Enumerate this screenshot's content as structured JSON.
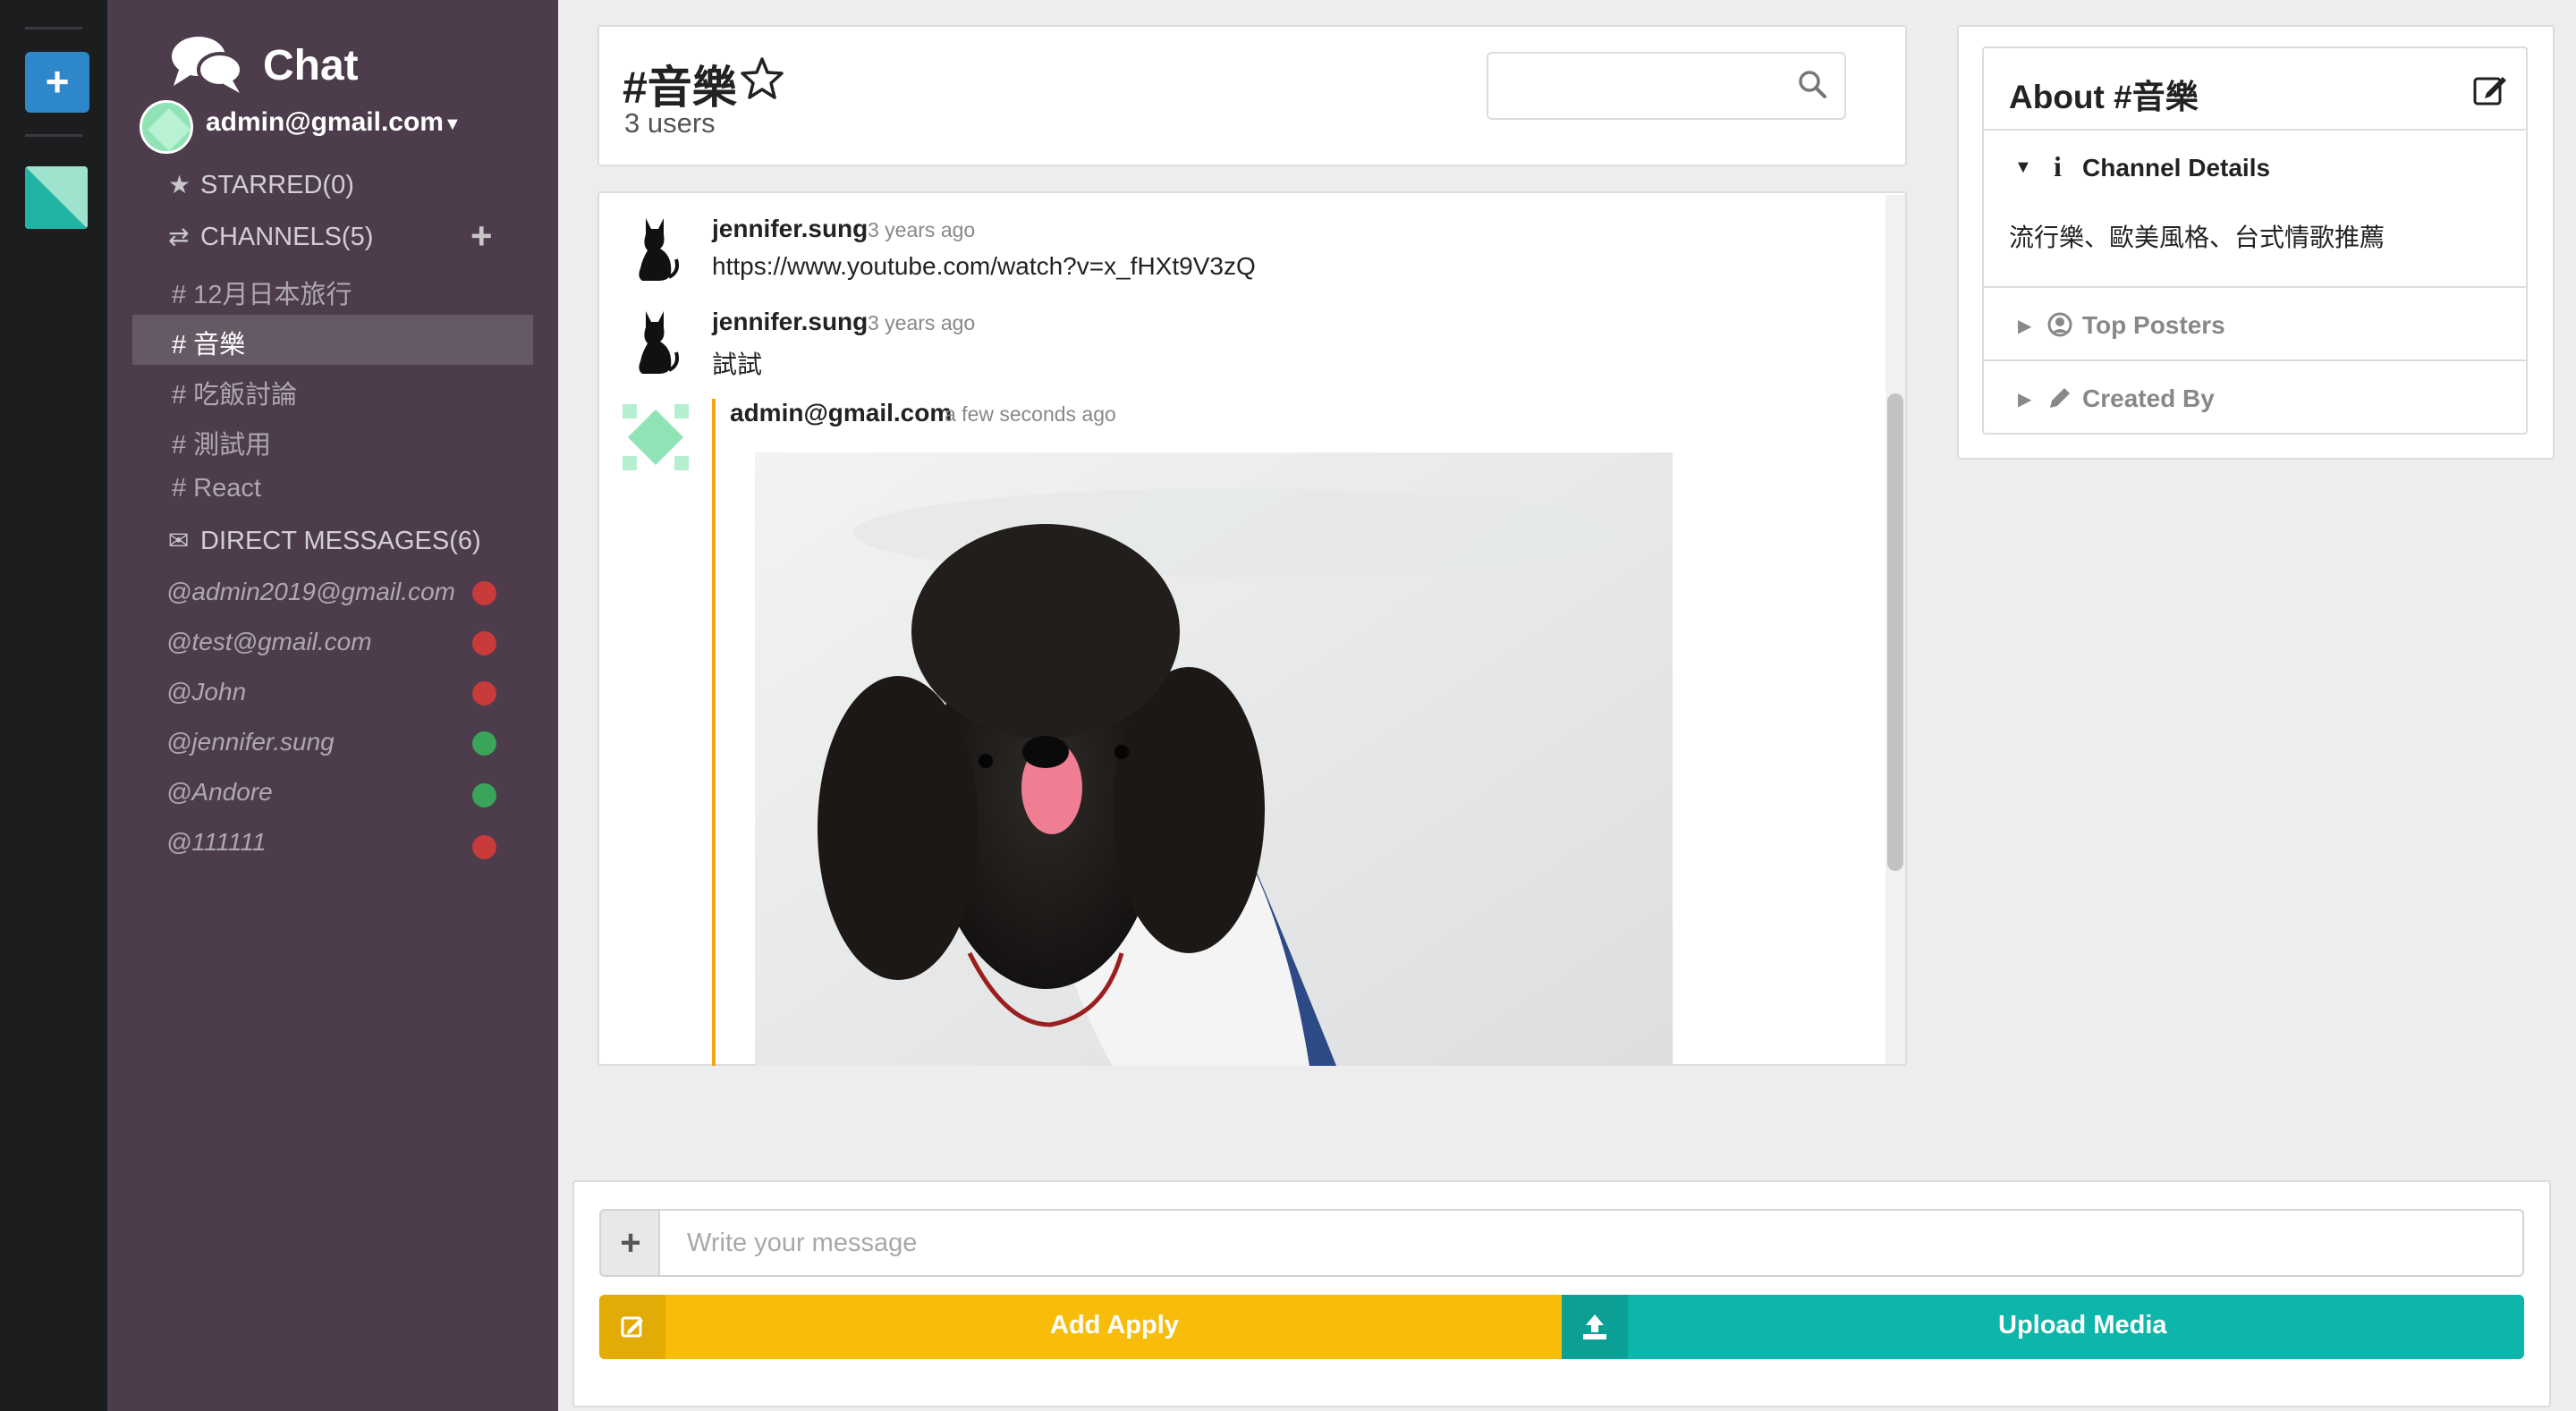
{
  "app": {
    "title": "Chat"
  },
  "user": {
    "email": "admin@gmail.com"
  },
  "sidebar": {
    "starred_label": "STARRED(0)",
    "channels_label": "CHANNELS(5)",
    "channels": [
      "# 12月日本旅行",
      "# 音樂",
      "# 吃飯討論",
      "# 測試用",
      "# React"
    ],
    "active_channel_index": 1,
    "dms_label": "DIRECT MESSAGES(6)",
    "dms": [
      {
        "name": "@admin2019@gmail.com",
        "status": "offline"
      },
      {
        "name": "@test@gmail.com",
        "status": "offline"
      },
      {
        "name": "@John",
        "status": "offline"
      },
      {
        "name": "@jennifer.sung",
        "status": "online"
      },
      {
        "name": "@Andore",
        "status": "online"
      },
      {
        "name": "@111111",
        "status": "offline"
      }
    ]
  },
  "channel": {
    "title": "#音樂",
    "users": "3 users"
  },
  "search": {
    "placeholder": ""
  },
  "messages": [
    {
      "author": "jennifer.sung",
      "time": "3 years ago",
      "text": "https://www.youtube.com/watch?v=x_fHXt9V3zQ"
    },
    {
      "author": "jennifer.sung",
      "time": "3 years ago",
      "text": "試試"
    },
    {
      "author": "admin@gmail.com",
      "time": "a few seconds ago",
      "image": "photo of a black poodle licking its nose"
    }
  ],
  "about": {
    "title": "About #音樂",
    "channel_details": "Channel Details",
    "description": "流行樂、歐美風格、台式情歌推薦",
    "top_posters": "Top Posters",
    "created_by": "Created By"
  },
  "composer": {
    "placeholder": "Write your message",
    "add_apply": "Add Apply",
    "upload_media": "Upload Media"
  },
  "colors": {
    "rail": "#1c1d1f",
    "sidebar": "#4c3c4c",
    "online": "#3aa55a",
    "offline": "#c93a3a",
    "add_apply": "#f8bd0a",
    "upload_media": "#0eb5aa",
    "accent_bar": "#f3a712",
    "new_team_button": "#2d87c9"
  }
}
